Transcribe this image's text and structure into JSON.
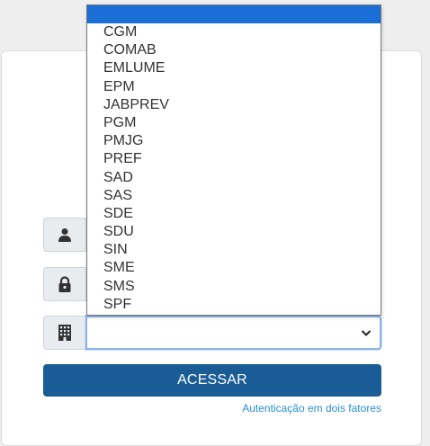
{
  "form": {
    "username_icon": "user-icon",
    "password_icon": "lock-icon",
    "organization_icon": "building-icon",
    "organization_selected": "",
    "submit_label": "ACESSAR",
    "two_factor_link": "Autenticação em dois fatores"
  },
  "dropdown": {
    "options": [
      "",
      "CGM",
      "COMAB",
      "EMLUME",
      "EPM",
      "JABPREV",
      "PGM",
      "PMJG",
      "PREF",
      "SAD",
      "SAS",
      "SDE",
      "SDU",
      "SIN",
      "SME",
      "SMS",
      "SPF"
    ],
    "highlighted_index": 0
  },
  "colors": {
    "primary_button": "#1a5c96",
    "link": "#2a8fd0",
    "highlight": "#1a6fd6",
    "focus_border": "#8ab4e8"
  }
}
